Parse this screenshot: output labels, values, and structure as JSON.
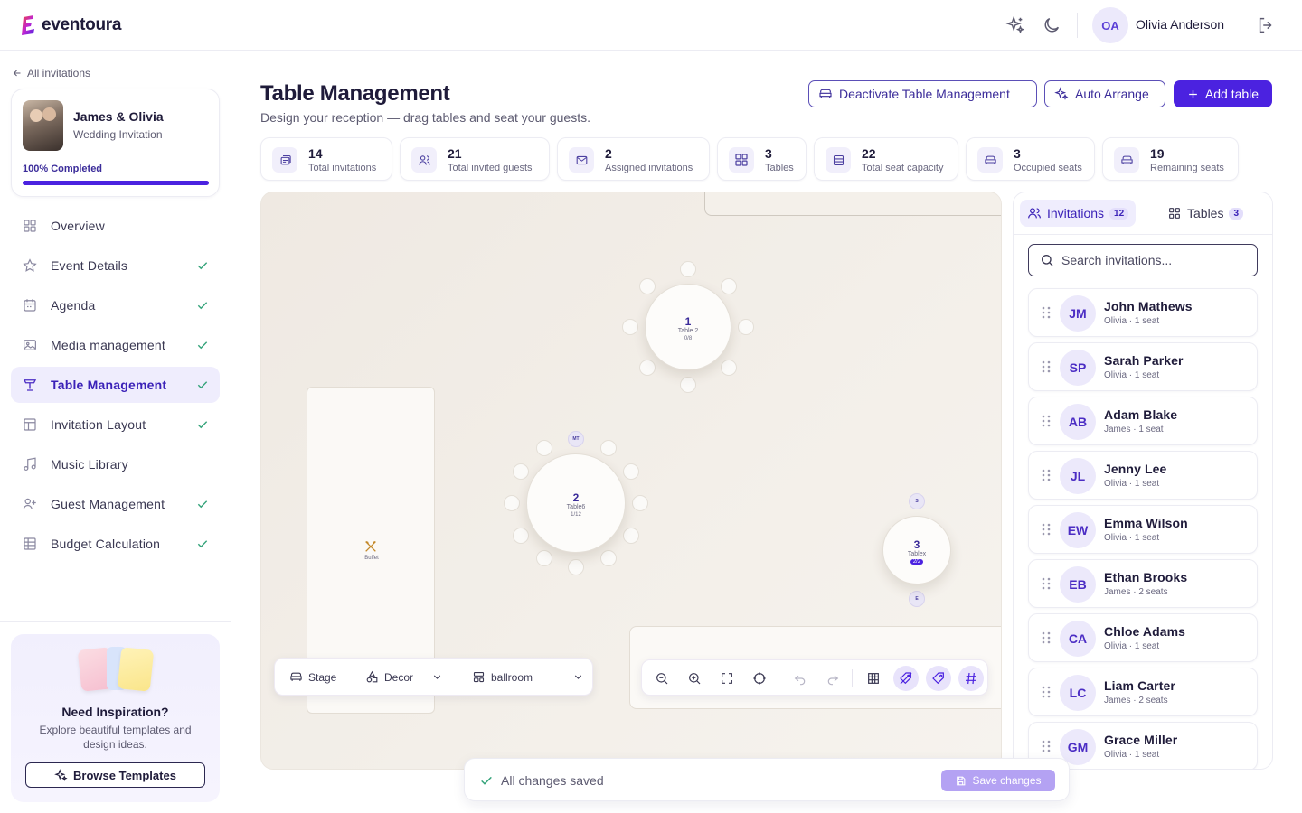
{
  "app": {
    "logo_letter": "e",
    "logo_text": "eventoura"
  },
  "user": {
    "initials": "OA",
    "name": "Olivia Anderson"
  },
  "sidebar": {
    "back_label": "All invitations",
    "event": {
      "name": "James & Olivia",
      "type": "Wedding Invitation",
      "progress_label": "100% Completed",
      "progress": 1.0
    },
    "items": [
      {
        "label": "Overview",
        "icon": "grid-icon",
        "done": false,
        "active": false
      },
      {
        "label": "Event Details",
        "icon": "star-icon",
        "done": true,
        "active": false
      },
      {
        "label": "Agenda",
        "icon": "calendar-icon",
        "done": true,
        "active": false
      },
      {
        "label": "Media management",
        "icon": "image-icon",
        "done": true,
        "active": false
      },
      {
        "label": "Table Management",
        "icon": "table-icon",
        "done": true,
        "active": true
      },
      {
        "label": "Invitation Layout",
        "icon": "layout-icon",
        "done": true,
        "active": false
      },
      {
        "label": "Music Library",
        "icon": "music-icon",
        "done": false,
        "active": false
      },
      {
        "label": "Guest Management",
        "icon": "user-plus-icon",
        "done": true,
        "active": false
      },
      {
        "label": "Budget Calculation",
        "icon": "spreadsheet-icon",
        "done": true,
        "active": false
      }
    ],
    "inspiration": {
      "title": "Need Inspiration?",
      "desc": "Explore beautiful templates and design ideas.",
      "button": "Browse Templates"
    }
  },
  "header": {
    "title": "Table Management",
    "subtitle": "Design your reception — drag tables and seat your guests.",
    "deactivate_label": "Deactivate Table Management",
    "auto_arrange_label": "Auto Arrange",
    "add_table_label": "Add table"
  },
  "stats": [
    {
      "value": "14",
      "label": "Total invitations",
      "icon": "invitations-icon"
    },
    {
      "value": "21",
      "label": "Total invited guests",
      "icon": "users-icon"
    },
    {
      "value": "2",
      "label": "Assigned invitations",
      "icon": "mail-icon"
    },
    {
      "value": "3",
      "label": "Tables",
      "icon": "grid-icon"
    },
    {
      "value": "22",
      "label": "Total seat capacity",
      "icon": "list-icon"
    },
    {
      "value": "3",
      "label": "Occupied seats",
      "icon": "sofa-icon"
    },
    {
      "value": "19",
      "label": "Remaining seats",
      "icon": "sofa-icon"
    }
  ],
  "canvas": {
    "buffet_label": "Buffet",
    "tables": [
      {
        "number": "1",
        "name": "Table 2",
        "occupancy": "0/8"
      },
      {
        "number": "2",
        "name": "Table6",
        "occupancy": "1/12",
        "seat_label": "MT"
      },
      {
        "number": "3",
        "name": "Tablex",
        "occupancy": "2/2",
        "seat_top": "S",
        "seat_bottom": "E"
      }
    ],
    "toolbar": {
      "stage": "Stage",
      "decor": "Decor",
      "venue": "ballroom"
    }
  },
  "panel": {
    "tabs": [
      {
        "label": "Invitations",
        "count": "12"
      },
      {
        "label": "Tables",
        "count": "3"
      }
    ],
    "search_placeholder": "Search invitations...",
    "invitations": [
      {
        "initials": "JM",
        "name": "John Mathews",
        "meta": "Olivia · 1 seat"
      },
      {
        "initials": "SP",
        "name": "Sarah Parker",
        "meta": "Olivia · 1 seat"
      },
      {
        "initials": "AB",
        "name": "Adam Blake",
        "meta": "James · 1 seat"
      },
      {
        "initials": "JL",
        "name": "Jenny Lee",
        "meta": "Olivia · 1 seat"
      },
      {
        "initials": "EW",
        "name": "Emma Wilson",
        "meta": "Olivia · 1 seat"
      },
      {
        "initials": "EB",
        "name": "Ethan Brooks",
        "meta": "James · 2 seats"
      },
      {
        "initials": "CA",
        "name": "Chloe Adams",
        "meta": "Olivia · 1 seat"
      },
      {
        "initials": "LC",
        "name": "Liam Carter",
        "meta": "James · 2 seats"
      },
      {
        "initials": "GM",
        "name": "Grace Miller",
        "meta": "Olivia · 1 seat"
      }
    ]
  },
  "savebar": {
    "status": "All changes saved",
    "button": "Save changes"
  },
  "colors": {
    "accent": "#4b22e0",
    "success": "#34a37a",
    "canvas_bg": "#efe9e2"
  }
}
